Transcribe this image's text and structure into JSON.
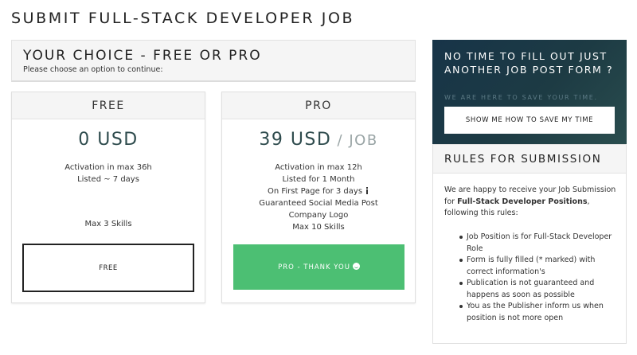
{
  "page": {
    "title": "SUBMIT FULL-STACK DEVELOPER JOB"
  },
  "choice": {
    "title": "YOUR CHOICE - FREE OR PRO",
    "subtitle": "Please choose an option to continue:"
  },
  "plans": {
    "free": {
      "name": "FREE",
      "price": "0 USD",
      "features": [
        "Activation in max 36h",
        "Listed ~ 7 days"
      ],
      "skills": "Max 3 Skills",
      "button_label": "FREE"
    },
    "pro": {
      "name": "PRO",
      "price": "39 USD",
      "per": " / JOB",
      "features": [
        "Activation in max 12h",
        "Listed for 1 Month",
        "On First Page for 3 days",
        "Guaranteed Social Media Post",
        "Company Logo",
        "Max 10 Skills"
      ],
      "button_label": "PRO - THANK YOU",
      "button_color": "#4cbf73"
    }
  },
  "promo": {
    "title": "NO TIME TO FILL OUT JUST ANOTHER JOB POST FORM ?",
    "subtitle": "WE ARE HERE TO SAVE YOUR TIME.",
    "button_label": "SHOW ME HOW TO SAVE MY TIME"
  },
  "rules": {
    "title": "RULES FOR SUBMISSION",
    "intro_before": "We are happy to receive your Job Submission for ",
    "intro_bold": "Full-Stack Developer Positions",
    "intro_after": ", following this rules:",
    "items": [
      "Job Position is for Full-Stack Developer Role",
      "Form is fully filled (* marked) with correct information's",
      "Publication is not guaranteed and happens as soon as possible",
      "You as the Publisher inform us when position is not more open"
    ]
  },
  "icons": {
    "info": "info-icon",
    "smile": "smile-icon"
  }
}
